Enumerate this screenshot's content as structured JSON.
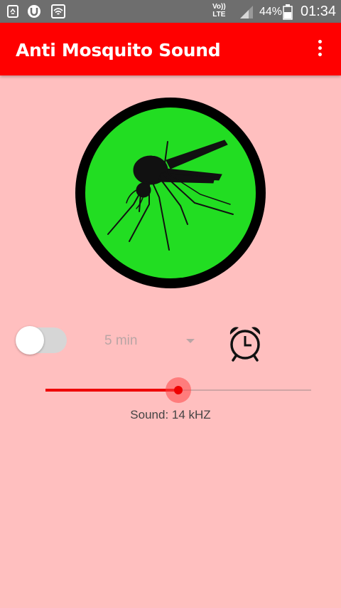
{
  "status_bar": {
    "icons": [
      "recycle-icon",
      "torrent-icon",
      "wifi-icon",
      "signal-icon",
      "battery-icon"
    ],
    "volte_line1": "Vo))",
    "volte_line2": "LTE",
    "battery_percent": "44%",
    "time": "01:34"
  },
  "app_bar": {
    "title": "Anti Mosquito Sound",
    "overflow_icon": "more-vert-icon"
  },
  "main": {
    "mosquito_button_icon": "mosquito-icon",
    "timer_toggle_on": false,
    "duration_selected": "5 min",
    "alarm_icon": "alarm-clock-icon",
    "slider_value_fraction": 0.5,
    "sound_label": "Sound: 14 kHZ"
  },
  "colors": {
    "app_bar": "#ff0000",
    "background": "#ffbfbf",
    "circle_fill": "#22dd22",
    "accent": "#ee0000"
  }
}
